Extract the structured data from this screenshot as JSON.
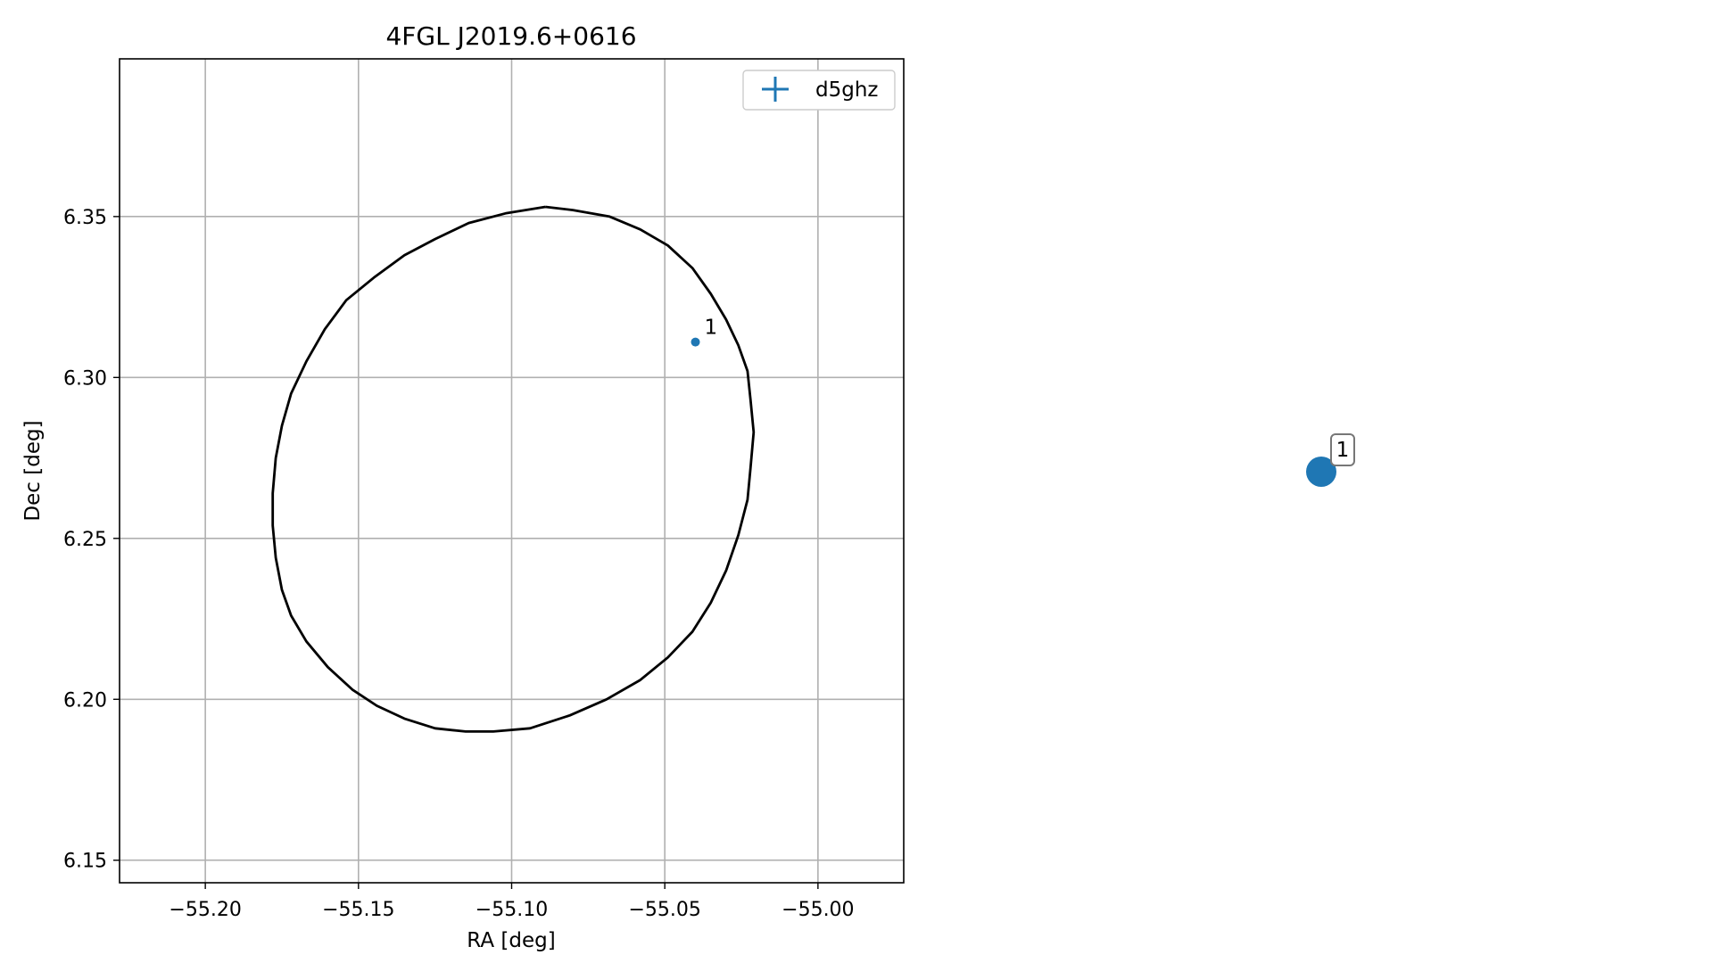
{
  "chart_data": [
    {
      "type": "scatter",
      "title": "4FGL J2019.6+0616",
      "xlabel": "RA [deg]",
      "ylabel": "Dec [deg]",
      "xlim": [
        -55.228,
        -54.972
      ],
      "ylim": [
        6.143,
        6.399
      ],
      "xticks": [
        -55.2,
        -55.15,
        -55.1,
        -55.05,
        -55.0
      ],
      "xtick_labels": [
        "−55.20",
        "−55.15",
        "−55.10",
        "−55.05",
        "−55.00"
      ],
      "yticks": [
        6.15,
        6.2,
        6.25,
        6.3,
        6.35
      ],
      "ytick_labels": [
        "6.15",
        "6.20",
        "6.25",
        "6.30",
        "6.35"
      ],
      "grid": true,
      "legend": {
        "placement": "top-right",
        "entries": [
          "d5ghz"
        ]
      },
      "series": [
        {
          "name": "d5ghz",
          "color": "#1f77b4",
          "points": [
            {
              "x": -55.04,
              "y": 6.311,
              "label": "1"
            }
          ]
        }
      ],
      "ellipse": {
        "color": "#000000",
        "points": [
          [
            -55.089,
            6.353
          ],
          [
            -55.08,
            6.352
          ],
          [
            -55.068,
            6.35
          ],
          [
            -55.058,
            6.346
          ],
          [
            -55.049,
            6.341
          ],
          [
            -55.041,
            6.334
          ],
          [
            -55.035,
            6.326
          ],
          [
            -55.03,
            6.318
          ],
          [
            -55.026,
            6.31
          ],
          [
            -55.023,
            6.302
          ],
          [
            -55.022,
            6.293
          ],
          [
            -55.021,
            6.283
          ],
          [
            -55.022,
            6.272
          ],
          [
            -55.023,
            6.262
          ],
          [
            -55.026,
            6.251
          ],
          [
            -55.03,
            6.24
          ],
          [
            -55.035,
            6.23
          ],
          [
            -55.041,
            6.221
          ],
          [
            -55.049,
            6.213
          ],
          [
            -55.058,
            6.206
          ],
          [
            -55.069,
            6.2
          ],
          [
            -55.081,
            6.195
          ],
          [
            -55.094,
            6.191
          ],
          [
            -55.106,
            6.19
          ],
          [
            -55.115,
            6.19
          ],
          [
            -55.125,
            6.191
          ],
          [
            -55.135,
            6.194
          ],
          [
            -55.144,
            6.198
          ],
          [
            -55.152,
            6.203
          ],
          [
            -55.16,
            6.21
          ],
          [
            -55.167,
            6.218
          ],
          [
            -55.172,
            6.226
          ],
          [
            -55.175,
            6.234
          ],
          [
            -55.177,
            6.244
          ],
          [
            -55.178,
            6.254
          ],
          [
            -55.178,
            6.264
          ],
          [
            -55.177,
            6.275
          ],
          [
            -55.175,
            6.285
          ],
          [
            -55.172,
            6.295
          ],
          [
            -55.167,
            6.305
          ],
          [
            -55.161,
            6.315
          ],
          [
            -55.154,
            6.324
          ],
          [
            -55.145,
            6.331
          ],
          [
            -55.135,
            6.338
          ],
          [
            -55.125,
            6.343
          ],
          [
            -55.114,
            6.348
          ],
          [
            -55.102,
            6.351
          ],
          [
            -55.089,
            6.353
          ]
        ]
      }
    },
    {
      "type": "scatter",
      "series": [
        {
          "color": "#1f77b4",
          "points": [
            {
              "label": "1"
            }
          ]
        }
      ]
    }
  ]
}
